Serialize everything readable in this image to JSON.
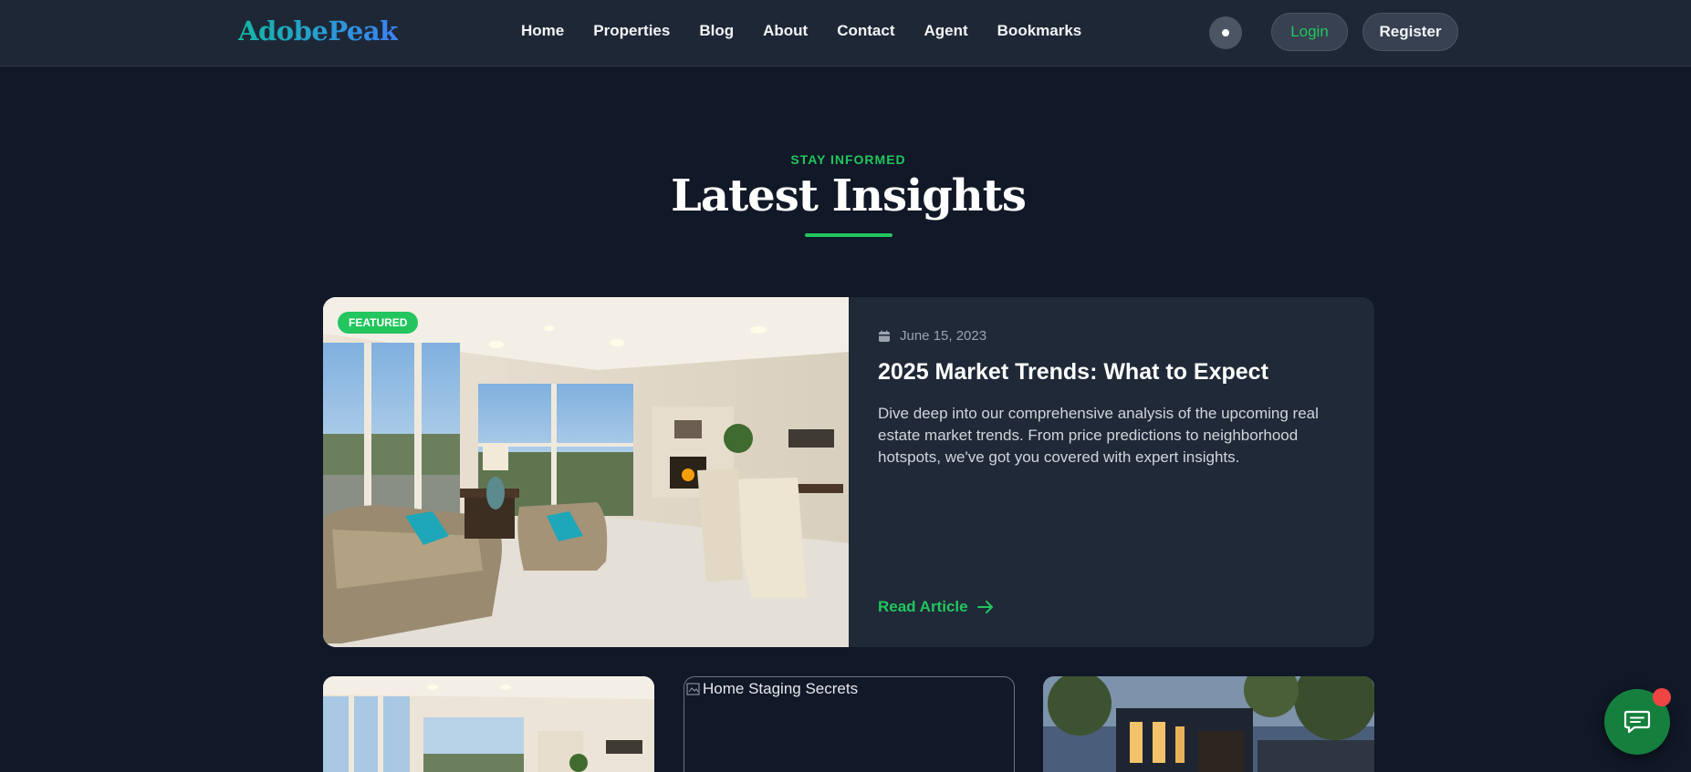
{
  "brand": {
    "logo_text": "AdobePeak"
  },
  "nav": {
    "links": [
      "Home",
      "Properties",
      "Blog",
      "About",
      "Contact",
      "Agent",
      "Bookmarks"
    ],
    "login_label": "Login",
    "register_label": "Register"
  },
  "section": {
    "eyebrow": "STAY INFORMED",
    "title": "Latest Insights"
  },
  "featured": {
    "badge": "FEATURED",
    "date": "June 15, 2023",
    "title": "2025 Market Trends: What to Expect",
    "excerpt": "Dive deep into our comprehensive analysis of the upcoming real estate market trends. From price predictions to neighborhood hotspots, we've got you covered with expert insights.",
    "read_label": "Read Article"
  },
  "cards": [
    {
      "image_alt": ""
    },
    {
      "image_alt": "Home Staging Secrets"
    },
    {
      "image_alt": ""
    }
  ],
  "colors": {
    "background": "#111827",
    "navbar": "#1e2736",
    "card": "#1f2937",
    "accent": "#22c55e",
    "chat_button": "#15803d",
    "notification": "#ef4444"
  },
  "icons": [
    "calendar-icon",
    "arrow-right-icon",
    "chat-icon",
    "broken-image-icon"
  ]
}
